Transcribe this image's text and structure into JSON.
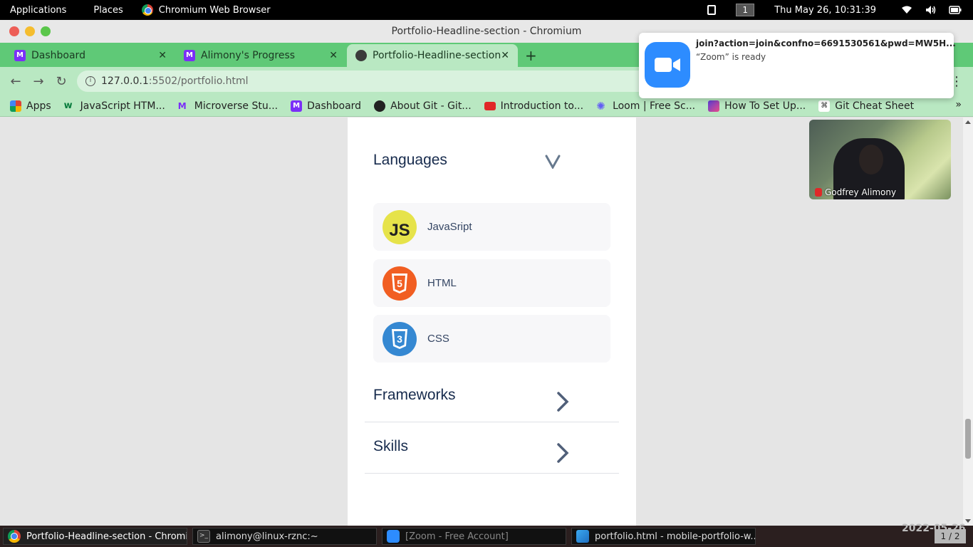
{
  "topbar": {
    "applications": "Applications",
    "places": "Places",
    "active_app": "Chromium Web Browser",
    "workspace": "1",
    "clock": "Thu May 26, 10:31:39"
  },
  "window": {
    "title": "Portfolio-Headline-section - Chromium"
  },
  "tabs": [
    {
      "label": "Dashboard"
    },
    {
      "label": "Alimony's Progress"
    },
    {
      "label": "Portfolio-Headline-section"
    }
  ],
  "address": {
    "host": "127.0.0.1",
    "rest": ":5502/portfolio.html"
  },
  "bookmarks": [
    {
      "label": "Apps"
    },
    {
      "label": "JavaScript HTM..."
    },
    {
      "label": "Microverse Stu..."
    },
    {
      "label": "Dashboard"
    },
    {
      "label": "About Git - Git..."
    },
    {
      "label": "Introduction to..."
    },
    {
      "label": "Loom | Free Sc..."
    },
    {
      "label": "How To Set Up..."
    },
    {
      "label": "Git Cheat Sheet"
    }
  ],
  "page": {
    "languages_heading": "Languages",
    "languages": [
      {
        "label": "JavaSript",
        "logo_text": "JS"
      },
      {
        "label": "HTML",
        "logo_text": "5"
      },
      {
        "label": "CSS",
        "logo_text": "3"
      }
    ],
    "frameworks_heading": "Frameworks",
    "skills_heading": "Skills"
  },
  "notification": {
    "title": "join?action=join&confno=6691530561&pwd=MW5H...",
    "body": "“Zoom” is ready"
  },
  "video": {
    "participant": "Godfrey Alimony"
  },
  "taskbar": {
    "items": [
      {
        "label": "Portfolio-Headline-section - Chromi..."
      },
      {
        "label": "alimony@linux-rznc:~"
      },
      {
        "label": "[Zoom - Free Account]"
      },
      {
        "label": "portfolio.html - mobile-portfolio-w..."
      }
    ],
    "workspace_indicator": "1 / 2",
    "corner_date": "2022-05-26"
  },
  "colors": {
    "tab_strip": "#5fc977",
    "toolbar": "#b9e8c2",
    "heading_text": "#172b4d",
    "js": "#e6e34a",
    "html": "#f15e22",
    "css": "#3588d2",
    "zoom_blue": "#2d8cff"
  }
}
